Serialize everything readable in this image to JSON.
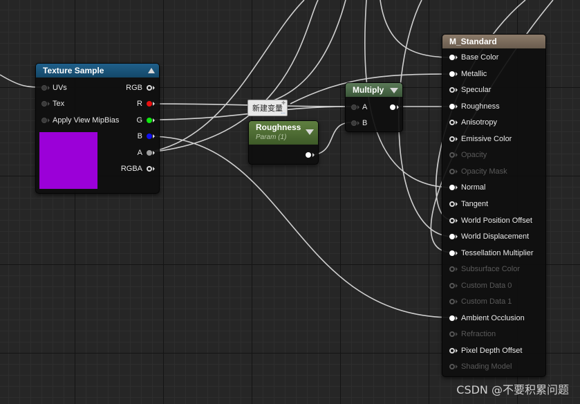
{
  "texture_sample": {
    "title": "Texture Sample",
    "inputs": [
      {
        "label": "UVs"
      },
      {
        "label": "Tex"
      },
      {
        "label": "Apply View MipBias"
      }
    ],
    "outputs": [
      {
        "label": "RGB",
        "color": "#d8d8d8",
        "style": "ring"
      },
      {
        "label": "R",
        "color": "#e81010",
        "style": "filled"
      },
      {
        "label": "G",
        "color": "#10e810",
        "style": "filled"
      },
      {
        "label": "B",
        "color": "#1010f0",
        "style": "filled"
      },
      {
        "label": "A",
        "color": "#a0a0a0",
        "style": "filled"
      },
      {
        "label": "RGBA",
        "color": "#d8d8d8",
        "style": "ring"
      }
    ],
    "preview_color": "#9b00d8"
  },
  "tooltip": {
    "text": "新建变量"
  },
  "roughness_param": {
    "title": "Roughness",
    "subtitle": "Param (1)"
  },
  "multiply": {
    "title": "Multiply",
    "inputs": [
      {
        "label": "A"
      },
      {
        "label": "B"
      }
    ]
  },
  "material": {
    "title": "M_Standard",
    "pins": [
      {
        "label": "Base Color",
        "active": true,
        "style": "filled"
      },
      {
        "label": "Metallic",
        "active": true,
        "style": "filled"
      },
      {
        "label": "Specular",
        "active": true,
        "style": "ring"
      },
      {
        "label": "Roughness",
        "active": true,
        "style": "filled"
      },
      {
        "label": "Anisotropy",
        "active": true,
        "style": "ring"
      },
      {
        "label": "Emissive Color",
        "active": true,
        "style": "ring"
      },
      {
        "label": "Opacity",
        "active": false,
        "style": "ring"
      },
      {
        "label": "Opacity Mask",
        "active": false,
        "style": "ring"
      },
      {
        "label": "Normal",
        "active": true,
        "style": "filled"
      },
      {
        "label": "Tangent",
        "active": true,
        "style": "ring"
      },
      {
        "label": "World Position Offset",
        "active": true,
        "style": "ring"
      },
      {
        "label": "World Displacement",
        "active": true,
        "style": "filled"
      },
      {
        "label": "Tessellation Multiplier",
        "active": true,
        "style": "filled"
      },
      {
        "label": "Subsurface Color",
        "active": false,
        "style": "ring"
      },
      {
        "label": "Custom Data 0",
        "active": false,
        "style": "ring"
      },
      {
        "label": "Custom Data 1",
        "active": false,
        "style": "ring"
      },
      {
        "label": "Ambient Occlusion",
        "active": true,
        "style": "filled"
      },
      {
        "label": "Refraction",
        "active": false,
        "style": "ring"
      },
      {
        "label": "Pixel Depth Offset",
        "active": true,
        "style": "ring"
      },
      {
        "label": "Shading Model",
        "active": false,
        "style": "ring"
      }
    ]
  },
  "watermark": "CSDN @不要积累问题",
  "colors": {
    "wire": "#d0d0d0",
    "graph_bg": "#262626",
    "texture_header": "#1f5f8a",
    "param_header": "#5f7f40",
    "multiply_header": "#5b7a58",
    "material_header": "#8c7b6a"
  }
}
